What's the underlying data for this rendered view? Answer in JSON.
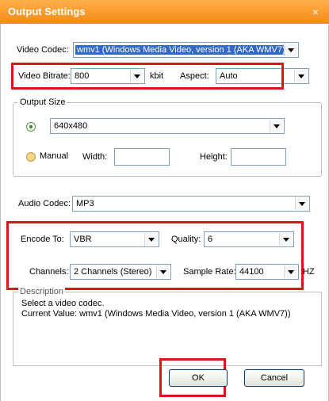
{
  "window": {
    "title": "Output Settings",
    "close_label": "×"
  },
  "video_codec": {
    "label": "Video Codec:",
    "value": "wmv1 (Windows Media Video, version 1 (AKA WMV7))"
  },
  "video_bitrate": {
    "label": "Video Bitrate:",
    "value": "800",
    "unit": "kbit"
  },
  "aspect": {
    "label": "Aspect:",
    "value": "Auto"
  },
  "output_size": {
    "group_title": "Output Size",
    "preset_value": "640x480",
    "manual_label": "Manual",
    "width_label": "Width:",
    "height_label": "Height:",
    "width_value": "",
    "height_value": ""
  },
  "audio_codec": {
    "label": "Audio Codec:",
    "value": "MP3"
  },
  "encode_to": {
    "label": "Encode To:",
    "value": "VBR"
  },
  "quality": {
    "label": "Quality:",
    "value": "6"
  },
  "channels": {
    "label": "Channels:",
    "value": "2 Channels (Stereo)"
  },
  "sample_rate": {
    "label": "Sample Rate:",
    "value": "44100",
    "unit": "HZ"
  },
  "description": {
    "group_title": "Description",
    "line1": "Select a video codec.",
    "line2": "Current Value: wmv1 (Windows Media Video, version 1 (AKA WMV7))"
  },
  "buttons": {
    "ok": "OK",
    "cancel": "Cancel"
  },
  "colors": {
    "titlebar": "#f48a17",
    "highlight": "#d9141a",
    "selection": "#316ac5"
  }
}
